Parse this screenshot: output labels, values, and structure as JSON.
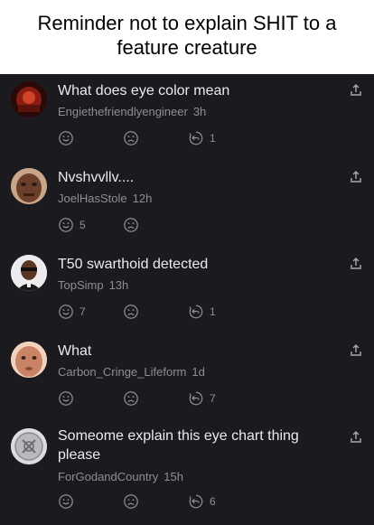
{
  "caption": "Reminder not to explain SHIT to a feature creature",
  "comments": [
    {
      "text": "What does eye color mean",
      "user": "Engiethefriendlyengineer",
      "time": "3h",
      "smile_count": "",
      "reply_count": "1"
    },
    {
      "text": "Nvshvvllv....",
      "user": "JoelHasStole",
      "time": "12h",
      "smile_count": "5",
      "reply_count": ""
    },
    {
      "text": "T50 swarthoid detected",
      "user": "TopSimp",
      "time": "13h",
      "smile_count": "7",
      "reply_count": "1"
    },
    {
      "text": "What",
      "user": "Carbon_Cringe_Lifeform",
      "time": "1d",
      "smile_count": "",
      "reply_count": "7"
    },
    {
      "text": "Someome explain this eye chart thing please",
      "user": "ForGodandCountry",
      "time": "15h",
      "smile_count": "",
      "reply_count": "6"
    }
  ],
  "icons": {
    "share": "share-icon",
    "smile": "smile-face-icon",
    "frown": "frown-face-icon",
    "reply": "reply-icon"
  },
  "colors": {
    "background": "#1b1b1f",
    "text": "#ebebef",
    "muted": "#8d8d96"
  }
}
